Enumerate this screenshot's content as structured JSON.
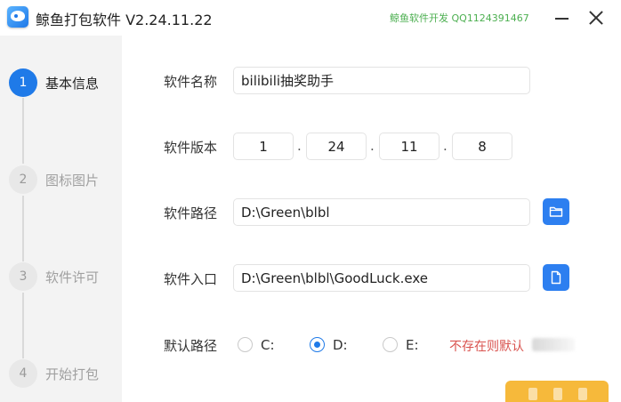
{
  "window": {
    "title": "鲸鱼打包软件 V2.24.11.22",
    "author": "鲸鱼软件开发 QQ1124391467"
  },
  "steps": [
    {
      "number": "1",
      "label": "基本信息",
      "active": true
    },
    {
      "number": "2",
      "label": "图标图片",
      "active": false
    },
    {
      "number": "3",
      "label": "软件许可",
      "active": false
    },
    {
      "number": "4",
      "label": "开始打包",
      "active": false
    }
  ],
  "form": {
    "name_label": "软件名称",
    "name_value": "bilibili抽奖助手",
    "version_label": "软件版本",
    "version": [
      "1",
      "24",
      "11",
      "8"
    ],
    "version_separator": ".",
    "path_label": "软件路径",
    "path_value": "D:\\Green\\blbl",
    "entry_label": "软件入口",
    "entry_value": "D:\\Green\\blbl\\GoodLuck.exe",
    "default_path_label": "默认路径",
    "drive_options": [
      {
        "label": "C:",
        "checked": false
      },
      {
        "label": "D:",
        "checked": true
      },
      {
        "label": "E:",
        "checked": false
      }
    ],
    "default_note": "不存在则默认"
  },
  "icons": {
    "folder_button": "folder-icon",
    "file_button": "file-icon"
  },
  "colors": {
    "accent": "#1f7ae8",
    "author_text": "#4caf50",
    "note_text": "#d9534f",
    "pack_button": "#f6b93b"
  }
}
